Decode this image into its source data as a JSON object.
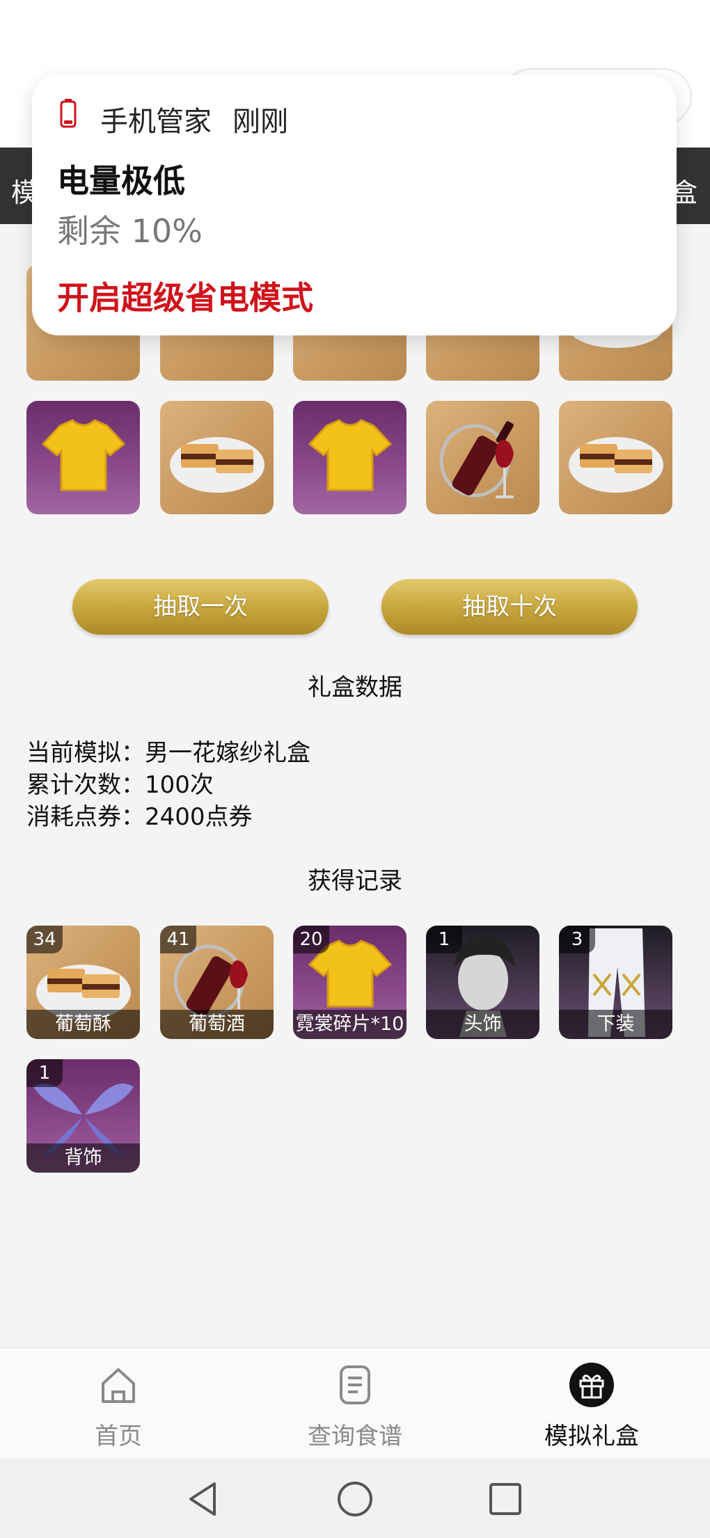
{
  "header": {
    "left_fragment": "模",
    "right_fragment": "盒"
  },
  "notification": {
    "icon": "battery-low-icon",
    "app_name": "手机管家",
    "time": "刚刚",
    "title": "电量极低",
    "body": "剩余 10%",
    "action": "开启超级省电模式"
  },
  "reward_grid": {
    "row1": [
      {
        "item": "wine",
        "icon": "wine-bottle-icon"
      },
      {
        "item": "wine",
        "icon": "wine-bottle-icon"
      },
      {
        "item": "wine",
        "icon": "wine-bottle-icon"
      },
      {
        "item": "wine",
        "icon": "wine-bottle-icon"
      },
      {
        "item": "cake",
        "icon": "cake-icon"
      }
    ],
    "row2": [
      {
        "item": "shirt",
        "icon": "shirt-icon"
      },
      {
        "item": "cake",
        "icon": "cake-icon"
      },
      {
        "item": "shirt",
        "icon": "shirt-icon"
      },
      {
        "item": "wine",
        "icon": "wine-bottle-icon"
      },
      {
        "item": "cake",
        "icon": "cake-icon"
      }
    ]
  },
  "buttons": {
    "draw_once": "抽取一次",
    "draw_ten": "抽取十次"
  },
  "box_data": {
    "title": "礼盒数据",
    "current_label": "当前模拟：",
    "current_value": "男一花嫁纱礼盒",
    "total_label": "累计次数：",
    "total_value": "100次",
    "cost_label": "消耗点券：",
    "cost_value": "2400点券"
  },
  "records": {
    "title": "获得记录",
    "items": [
      {
        "count": "34",
        "label": "葡萄酥",
        "icon": "cake-icon"
      },
      {
        "count": "41",
        "label": "葡萄酒",
        "icon": "wine-bottle-icon"
      },
      {
        "count": "20",
        "label": "霓裳碎片*10",
        "icon": "shirt-icon"
      },
      {
        "count": "1",
        "label": "头饰",
        "icon": "hairstyle-icon"
      },
      {
        "count": "3",
        "label": "下装",
        "icon": "pants-icon"
      },
      {
        "count": "1",
        "label": "背饰",
        "icon": "wings-icon"
      }
    ]
  },
  "bottom_nav": {
    "items": [
      {
        "label": "首页",
        "icon": "home-icon",
        "active": false
      },
      {
        "label": "查询食谱",
        "icon": "recipe-icon",
        "active": false
      },
      {
        "label": "模拟礼盒",
        "icon": "gift-icon",
        "active": true
      }
    ]
  },
  "system_nav": {
    "back": "back-icon",
    "home": "home-circle-icon",
    "recents": "recents-icon"
  },
  "colors": {
    "accent_red": "#d0121b",
    "header_dark": "#333333",
    "gold": "#c9a73f"
  }
}
